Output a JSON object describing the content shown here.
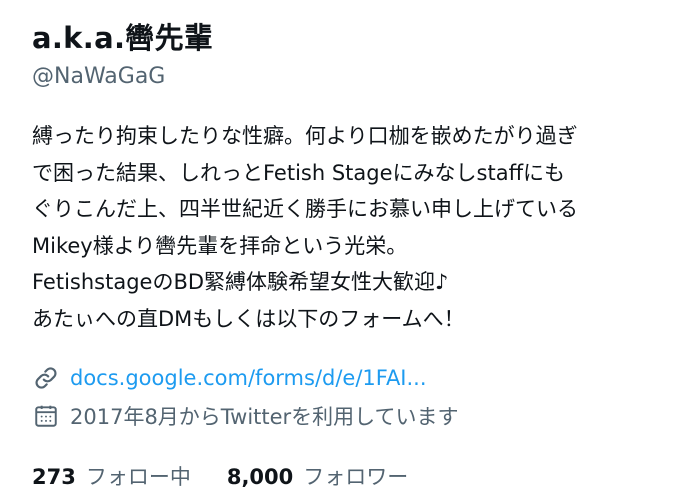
{
  "profile": {
    "display_name": "a.k.a.轡先輩",
    "handle": "@NaWaGaG",
    "bio_lines": [
      "縛ったり拘束したりな性癖。何より口枷を嵌めたがり過ぎ",
      "で困った結果、しれっとFetish Stageにみなしstaffにも",
      "ぐりこんだ上、四半世紀近く勝手にお慕い申し上げている",
      "Mikey様より轡先輩を拝命という光栄。",
      "FetishstageのBD緊縛体験希望女性大歓迎♪",
      "あたぃへの直DMもしくは以下のフォームへ！"
    ],
    "link": {
      "icon": "link-icon",
      "text": "docs.google.com/forms/d/e/1FAI..."
    },
    "joined": {
      "icon": "calendar-icon",
      "text": "2017年8月からTwitterを利用しています"
    },
    "following": {
      "count": "273",
      "label": "フォロー中"
    },
    "followers": {
      "count": "8,000",
      "label": "フォロワー"
    }
  },
  "colors": {
    "text": "#0f1419",
    "secondary": "#536471",
    "link": "#1d9bf0"
  }
}
